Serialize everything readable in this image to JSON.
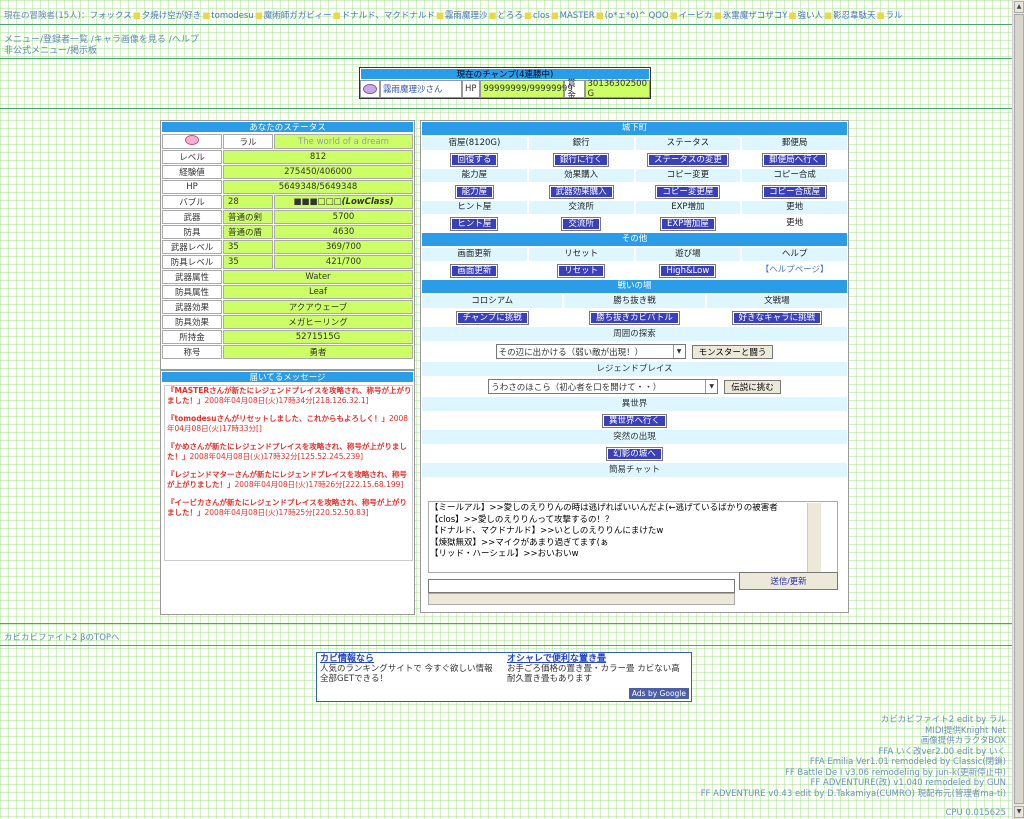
{
  "adventurers": {
    "label": "現在の冒険者(15人)：",
    "names": [
      "フォックス",
      "夕焼け空が好き",
      "tomodesu",
      "魔術師ガガビィー",
      "ドナルド、マクドナルド",
      "霧雨魔理沙",
      "どろろ",
      "clos",
      "MASTER",
      "(o*ェ*o)^ QOO",
      "イービカ",
      "氷雷魔ザコザコY",
      "強い人",
      "影忍韋駄天",
      "ラル"
    ]
  },
  "menu": {
    "line1": "メニュー/登録者一覧 /キャラ画像を見る /ヘルプ",
    "line2": "非公式メニュー/掲示板"
  },
  "champ": {
    "title": "現在のチャンプ(4連勝中)",
    "name": "霧雨魔理沙さん",
    "hp_label": "HP",
    "hp": "99999999/99999999",
    "prize_label": "賞金",
    "prize": "30136302500 G"
  },
  "status": {
    "title": "あなたのステータス",
    "name": "ラル",
    "motto": "The world of a dream",
    "rows": [
      {
        "label": "レベル",
        "value": "812"
      },
      {
        "label": "経験値",
        "value": "275450/406000"
      },
      {
        "label": "HP",
        "value": "5649348/5649348"
      }
    ],
    "bubble": {
      "label": "バブル",
      "num": "28",
      "gauge": "■■■□□□",
      "class": "(LowClass)"
    },
    "weapon": {
      "label": "武器",
      "name": "普通の剣",
      "value": "5700"
    },
    "armor": {
      "label": "防具",
      "name": "普通の盾",
      "value": "4630"
    },
    "weapon_level": {
      "label": "武器レベル",
      "lv": "35",
      "exp": "369/700"
    },
    "armor_level": {
      "label": "防具レベル",
      "lv": "35",
      "exp": "421/700"
    },
    "rows2": [
      {
        "label": "武器属性",
        "value": "Water"
      },
      {
        "label": "防具属性",
        "value": "Leaf"
      },
      {
        "label": "武器効果",
        "value": "アクアウェーブ"
      },
      {
        "label": "防具効果",
        "value": "メガヒーリング"
      },
      {
        "label": "所持金",
        "value": "5271515G"
      },
      {
        "label": "称号",
        "value": "勇者"
      }
    ]
  },
  "messages": {
    "title": "届いてるメッセージ",
    "items": [
      {
        "text": "『MASTERさんが新たにレジェンドプレイスを攻略され、称号が上がりました！」",
        "time": "2008年04月08日(火)17時34分[218.126.32.1]"
      },
      {
        "text": "『tomodesuさんがリセットしました、これからもよろしく！」",
        "time": "2008年04月08日(火)17時33分[]"
      },
      {
        "text": "『かめさんが新たにレジェンドプレイスを攻略され、称号が上がりました！」",
        "time": "2008年04月08日(火)17時32分[125.52.245.239]"
      },
      {
        "text": "『レジェンドマターさんが新たにレジェンドプレイスを攻略され、称号が上がりました！」",
        "time": "2008年04月08日(火)17時26分[222.15.68.199]"
      },
      {
        "text": "『イービカさんが新たにレジェンドプレイスを攻略され、称号が上がりました！」",
        "time": "2008年04月08日(火)17時25分[220.52.50.83]"
      }
    ]
  },
  "town": {
    "title": "城下町",
    "row1_labels": [
      "宿屋(8120G)",
      "銀行",
      "ステータス",
      "郵便局"
    ],
    "row1_buttons": [
      "回復する",
      "銀行に行く",
      "ステータスの変更",
      "郵便局へ行く"
    ],
    "row2_labels": [
      "能力屋",
      "効果購入",
      "コピー変更",
      "コピー合成"
    ],
    "row2_buttons": [
      "能力屋",
      "武器効果購入",
      "コピー変更屋",
      "コピー合成屋"
    ],
    "row3_labels": [
      "ヒント屋",
      "交流所",
      "EXP増加",
      "更地"
    ],
    "row3_buttons": [
      "ヒント屋",
      "交流所",
      "EXP増加屋"
    ],
    "row3_plain": "更地",
    "other_title": "その他",
    "other_labels": [
      "画面更新",
      "リセット",
      "遊び場",
      "ヘルプ"
    ],
    "other_buttons": [
      "画面更新",
      "リセット",
      "High&Low"
    ],
    "help_link": "【ヘルプページ】",
    "battle_title": "戦いの場",
    "battle_labels": [
      "コロシアム",
      "勝ち抜き戦",
      "文戦場"
    ],
    "battle_buttons": [
      "チャンプに挑戦",
      "勝ち抜きカビバトル",
      "好きなキャラに挑戦"
    ],
    "explore_title": "周囲の探索",
    "explore_select": "その辺に出かける（弱い敵が出現！）",
    "explore_button": "モンスターと闘う",
    "legend_title": "レジェンドプレイス",
    "legend_select": "うわさのほこら（初心者を口を開けて・・）",
    "legend_button": "伝説に挑む",
    "other_world_title": "異世界",
    "other_world_button": "異世界へ行く",
    "sudden_title": "突然の出現",
    "sudden_button": "幻影の城へ",
    "chat_title": "簡易チャット",
    "chat_lines": [
      "【ミールアル】>>愛しのえりりんの時は逃げればいいんだよ(←逃げているばかりの被害者",
      "【clos】>>愛しのえりりんって攻撃するの！？",
      "【ドナルド、マクドナルド】>>いとしのえりりんにまけたw",
      "【煉獄無双】>>マイクがあまり過ぎてます(ぁ",
      "【リッド・ハーシェル】>>おいおいw"
    ],
    "chat_button": "送信/更新"
  },
  "footer_link": "カビカビファイト2 βのTOPへ",
  "ads": {
    "ad1_title": "カビ情報なら",
    "ad1_body": "人気のランキングサイトで 今すぐ欲しい情報 全部GETできる！",
    "ad2_title": "オシャレで便利な置き畳",
    "ad2_body": "お手ごろ価格の置き畳・カラー畳 カビない高耐久置き畳もあります",
    "badge": "Ads by Google"
  },
  "credits": [
    "カビカビファイト2 edit by ラル",
    "MIDI提供Knight Net",
    "画像提供カラクタBOX",
    "FFA いく改ver2.00 edit by いく",
    "FFA Emilia Ver1.01 remodeled by Classic(閉鎖)",
    "FF Battle De I v3.06 remodeling by jun-k(更新停止中)",
    "FF ADVENTURE(改) v1.040 remodeled by GUN",
    "FF ADVENTURE v0.43 edit by D.Takamiya(CUMRO) 現配布元(管理者ma-ti)"
  ],
  "cpu": "CPU 0.015625"
}
